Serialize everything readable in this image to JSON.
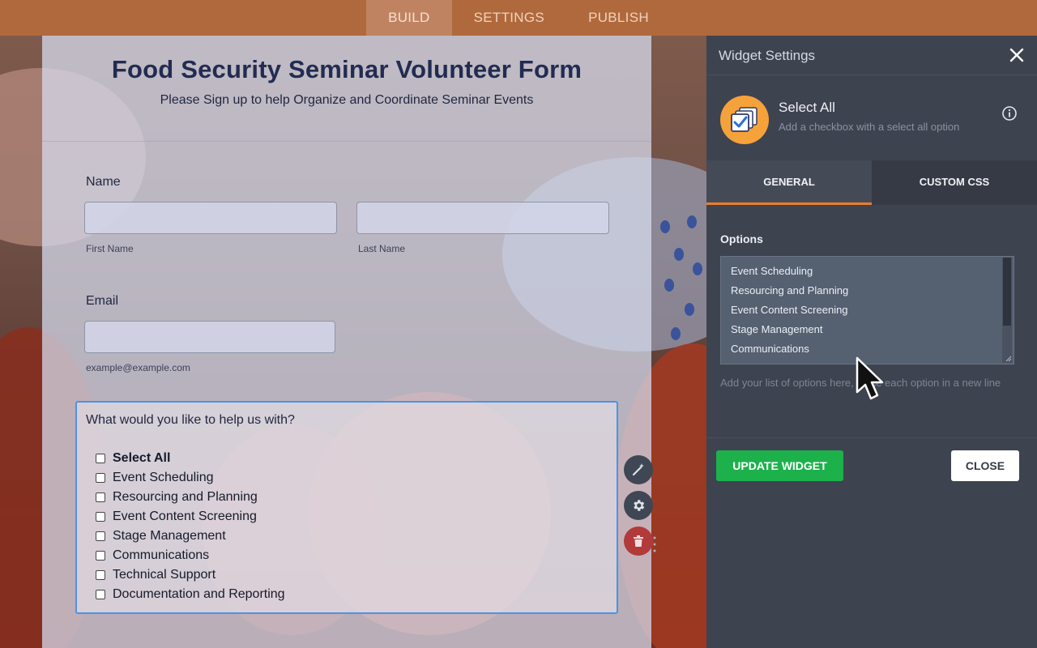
{
  "nav": {
    "tabs": [
      {
        "label": "BUILD",
        "active": true
      },
      {
        "label": "SETTINGS",
        "active": false
      },
      {
        "label": "PUBLISH",
        "active": false
      }
    ]
  },
  "form": {
    "title": "Food Security Seminar Volunteer Form",
    "subtitle": "Please Sign up to help Organize and Coordinate Seminar Events",
    "name": {
      "label": "Name",
      "first_value": "",
      "last_value": "",
      "first_sublabel": "First Name",
      "last_sublabel": "Last Name"
    },
    "email": {
      "label": "Email",
      "value": "",
      "sublabel": "example@example.com"
    },
    "checkbox_field": {
      "question": "What would you like to help us with?",
      "options": [
        {
          "label": "Select All",
          "checked": false
        },
        {
          "label": "Event Scheduling",
          "checked": false
        },
        {
          "label": "Resourcing and Planning",
          "checked": false
        },
        {
          "label": "Event Content Screening",
          "checked": false
        },
        {
          "label": "Stage Management",
          "checked": false
        },
        {
          "label": "Communications",
          "checked": false
        },
        {
          "label": "Technical Support",
          "checked": false
        },
        {
          "label": "Documentation and Reporting",
          "checked": false
        }
      ]
    },
    "side_actions": {
      "wand_icon": "magic-wand-icon",
      "gear_icon": "gear-icon",
      "delete_icon": "trash-icon"
    }
  },
  "panel": {
    "title": "Widget Settings",
    "widget_name": "Select All",
    "widget_description": "Add a checkbox with a select all option",
    "tabs": [
      {
        "label": "GENERAL",
        "active": true
      },
      {
        "label": "CUSTOM CSS",
        "active": false
      }
    ],
    "options_label": "Options",
    "options_lines": [
      "Event Scheduling",
      "Resourcing and Planning",
      "Event Content Screening",
      "Stage Management",
      "Communications"
    ],
    "hint": "Add your list of options here, place each option in a new line",
    "update_button": "UPDATE WIDGET",
    "close_button": "CLOSE"
  },
  "colors": {
    "accent_orange": "#f07b26",
    "nav_bg": "#b0693c",
    "update_green": "#1db14c",
    "focus_blue": "#4a93e6",
    "delete_red": "#b23a3a"
  }
}
